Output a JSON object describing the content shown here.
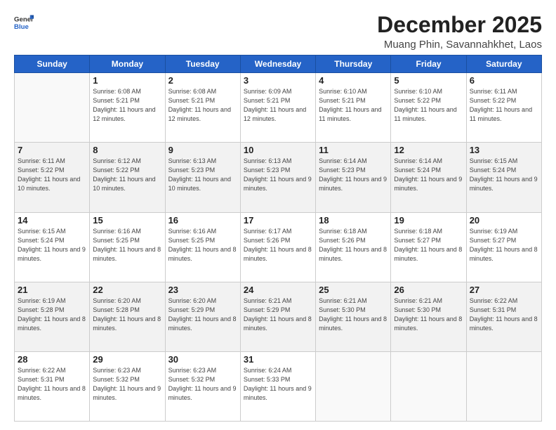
{
  "logo": {
    "line1": "General",
    "line2": "Blue"
  },
  "title": "December 2025",
  "location": "Muang Phin, Savannahkhet, Laos",
  "days_of_week": [
    "Sunday",
    "Monday",
    "Tuesday",
    "Wednesday",
    "Thursday",
    "Friday",
    "Saturday"
  ],
  "weeks": [
    [
      {
        "day": null
      },
      {
        "day": 1,
        "sunrise": "6:08 AM",
        "sunset": "5:21 PM",
        "daylight": "11 hours and 12 minutes."
      },
      {
        "day": 2,
        "sunrise": "6:08 AM",
        "sunset": "5:21 PM",
        "daylight": "11 hours and 12 minutes."
      },
      {
        "day": 3,
        "sunrise": "6:09 AM",
        "sunset": "5:21 PM",
        "daylight": "11 hours and 12 minutes."
      },
      {
        "day": 4,
        "sunrise": "6:10 AM",
        "sunset": "5:21 PM",
        "daylight": "11 hours and 11 minutes."
      },
      {
        "day": 5,
        "sunrise": "6:10 AM",
        "sunset": "5:22 PM",
        "daylight": "11 hours and 11 minutes."
      },
      {
        "day": 6,
        "sunrise": "6:11 AM",
        "sunset": "5:22 PM",
        "daylight": "11 hours and 11 minutes."
      }
    ],
    [
      {
        "day": 7,
        "sunrise": "6:11 AM",
        "sunset": "5:22 PM",
        "daylight": "11 hours and 10 minutes."
      },
      {
        "day": 8,
        "sunrise": "6:12 AM",
        "sunset": "5:22 PM",
        "daylight": "11 hours and 10 minutes."
      },
      {
        "day": 9,
        "sunrise": "6:13 AM",
        "sunset": "5:23 PM",
        "daylight": "11 hours and 10 minutes."
      },
      {
        "day": 10,
        "sunrise": "6:13 AM",
        "sunset": "5:23 PM",
        "daylight": "11 hours and 9 minutes."
      },
      {
        "day": 11,
        "sunrise": "6:14 AM",
        "sunset": "5:23 PM",
        "daylight": "11 hours and 9 minutes."
      },
      {
        "day": 12,
        "sunrise": "6:14 AM",
        "sunset": "5:24 PM",
        "daylight": "11 hours and 9 minutes."
      },
      {
        "day": 13,
        "sunrise": "6:15 AM",
        "sunset": "5:24 PM",
        "daylight": "11 hours and 9 minutes."
      }
    ],
    [
      {
        "day": 14,
        "sunrise": "6:15 AM",
        "sunset": "5:24 PM",
        "daylight": "11 hours and 9 minutes."
      },
      {
        "day": 15,
        "sunrise": "6:16 AM",
        "sunset": "5:25 PM",
        "daylight": "11 hours and 8 minutes."
      },
      {
        "day": 16,
        "sunrise": "6:16 AM",
        "sunset": "5:25 PM",
        "daylight": "11 hours and 8 minutes."
      },
      {
        "day": 17,
        "sunrise": "6:17 AM",
        "sunset": "5:26 PM",
        "daylight": "11 hours and 8 minutes."
      },
      {
        "day": 18,
        "sunrise": "6:18 AM",
        "sunset": "5:26 PM",
        "daylight": "11 hours and 8 minutes."
      },
      {
        "day": 19,
        "sunrise": "6:18 AM",
        "sunset": "5:27 PM",
        "daylight": "11 hours and 8 minutes."
      },
      {
        "day": 20,
        "sunrise": "6:19 AM",
        "sunset": "5:27 PM",
        "daylight": "11 hours and 8 minutes."
      }
    ],
    [
      {
        "day": 21,
        "sunrise": "6:19 AM",
        "sunset": "5:28 PM",
        "daylight": "11 hours and 8 minutes."
      },
      {
        "day": 22,
        "sunrise": "6:20 AM",
        "sunset": "5:28 PM",
        "daylight": "11 hours and 8 minutes."
      },
      {
        "day": 23,
        "sunrise": "6:20 AM",
        "sunset": "5:29 PM",
        "daylight": "11 hours and 8 minutes."
      },
      {
        "day": 24,
        "sunrise": "6:21 AM",
        "sunset": "5:29 PM",
        "daylight": "11 hours and 8 minutes."
      },
      {
        "day": 25,
        "sunrise": "6:21 AM",
        "sunset": "5:30 PM",
        "daylight": "11 hours and 8 minutes."
      },
      {
        "day": 26,
        "sunrise": "6:21 AM",
        "sunset": "5:30 PM",
        "daylight": "11 hours and 8 minutes."
      },
      {
        "day": 27,
        "sunrise": "6:22 AM",
        "sunset": "5:31 PM",
        "daylight": "11 hours and 8 minutes."
      }
    ],
    [
      {
        "day": 28,
        "sunrise": "6:22 AM",
        "sunset": "5:31 PM",
        "daylight": "11 hours and 8 minutes."
      },
      {
        "day": 29,
        "sunrise": "6:23 AM",
        "sunset": "5:32 PM",
        "daylight": "11 hours and 9 minutes."
      },
      {
        "day": 30,
        "sunrise": "6:23 AM",
        "sunset": "5:32 PM",
        "daylight": "11 hours and 9 minutes."
      },
      {
        "day": 31,
        "sunrise": "6:24 AM",
        "sunset": "5:33 PM",
        "daylight": "11 hours and 9 minutes."
      },
      {
        "day": null
      },
      {
        "day": null
      },
      {
        "day": null
      }
    ]
  ]
}
